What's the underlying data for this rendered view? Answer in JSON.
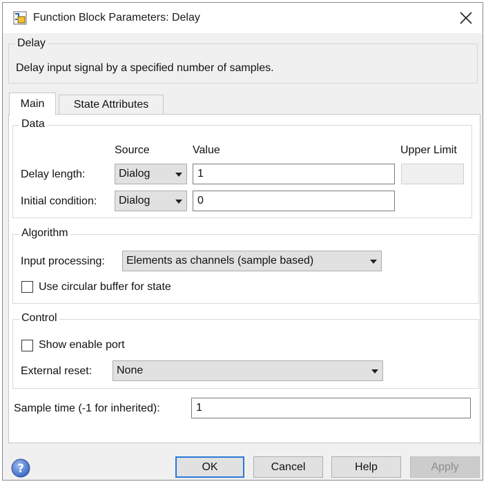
{
  "window": {
    "title": "Function Block Parameters: Delay"
  },
  "description": {
    "group_label": "Delay",
    "text": "Delay input signal by a specified number of samples."
  },
  "tabs": [
    {
      "label": "Main",
      "selected": true
    },
    {
      "label": "State Attributes",
      "selected": false
    }
  ],
  "data_group": {
    "label": "Data",
    "headers": {
      "source": "Source",
      "value": "Value",
      "upper_limit": "Upper Limit"
    },
    "rows": [
      {
        "label": "Delay length:",
        "source": "Dialog",
        "value": "1"
      },
      {
        "label": "Initial condition:",
        "source": "Dialog",
        "value": "0"
      }
    ]
  },
  "algorithm_group": {
    "label": "Algorithm",
    "input_processing_label": "Input processing:",
    "input_processing_value": "Elements as channels (sample based)",
    "circular_buffer_label": "Use circular buffer for state",
    "circular_buffer_checked": false
  },
  "control_group": {
    "label": "Control",
    "enable_port_label": "Show enable port",
    "enable_port_checked": false,
    "external_reset_label": "External reset:",
    "external_reset_value": "None"
  },
  "sample_time": {
    "label": "Sample time (-1 for inherited):",
    "value": "1"
  },
  "buttons": {
    "ok": "OK",
    "cancel": "Cancel",
    "help": "Help",
    "apply": "Apply"
  },
  "colors": {
    "default_button_border": "#2a78d6",
    "help_icon": "#4f7fcf"
  }
}
